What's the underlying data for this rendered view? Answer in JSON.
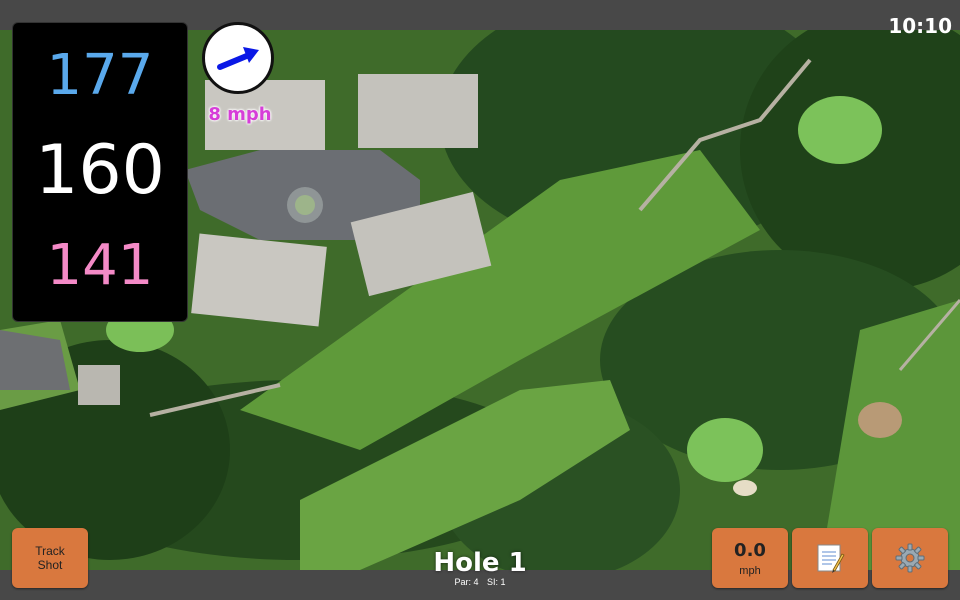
{
  "status_bar": {
    "time": "10:10"
  },
  "distances": {
    "back": "177",
    "center": "160",
    "front": "141"
  },
  "wind": {
    "speed_label": "8 mph",
    "direction_icon": "arrow-icon"
  },
  "track_shot": {
    "line1": "Track",
    "line2": "Shot"
  },
  "speed": {
    "value": "0.0",
    "unit": "mph"
  },
  "notes_button": {
    "icon": "notepad-icon"
  },
  "settings_button": {
    "icon": "gear-icon"
  },
  "hole": {
    "title": "Hole 1",
    "par": "Par: 4",
    "si": "SI: 1"
  },
  "colors": {
    "back": "#5aa9ec",
    "center": "#ffffff",
    "front": "#f48ac7",
    "wind": "#d63ed8",
    "button": "#d9783e",
    "arrow": "#0a18e6"
  }
}
